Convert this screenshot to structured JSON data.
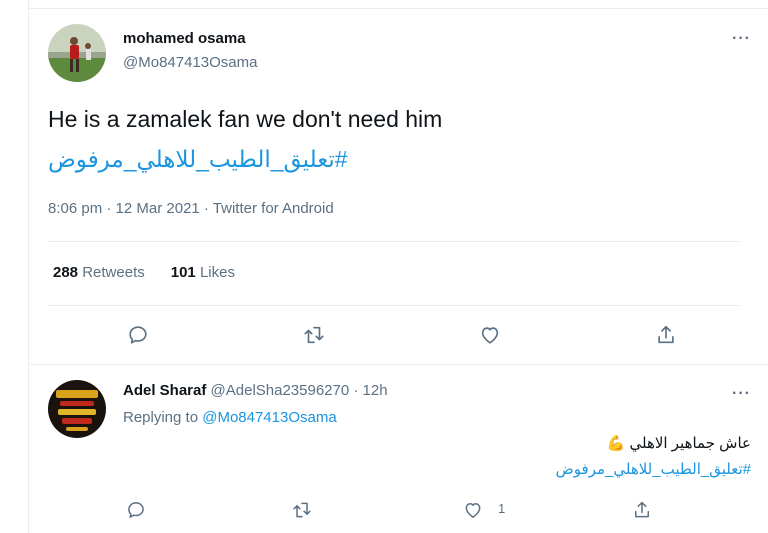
{
  "main_tweet": {
    "author_name": "mohamed osama",
    "author_handle": "@Mo847413Osama",
    "text": "He is a zamalek fan we don't need him",
    "hashtag": "#تعليق_الطيب_للاهلي_مرفوض",
    "meta": "8:06 pm · 12 Mar 2021 · Twitter for Android",
    "retweet_count": "288",
    "retweet_label": "Retweets",
    "like_count": "101",
    "like_label": "Likes",
    "more": "···"
  },
  "reply": {
    "author_name": "Adel Sharaf",
    "author_handle": "@AdelSha23596270",
    "time": "· 12h",
    "replying_prefix": "Replying to",
    "replying_to": "@Mo847413Osama",
    "text": "عاش جماهير الاهلي",
    "emoji": "💪",
    "hashtag": "#تعليق_الطيب_للاهلي_مرفوض",
    "like_count": "1",
    "more": "···"
  },
  "colors": {
    "link": "#1b95e0",
    "secondary": "#5b7083",
    "text": "#0f1419",
    "divider": "#ebeef0"
  }
}
